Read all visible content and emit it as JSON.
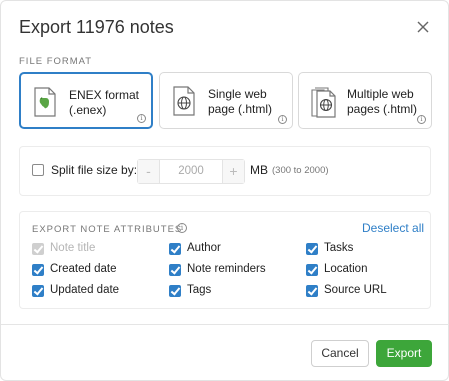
{
  "dialog": {
    "title": "Export 11976 notes",
    "close_icon": "close-icon"
  },
  "file_format": {
    "section_label": "FILE FORMAT",
    "options": [
      {
        "line1": "ENEX format",
        "line2": "(.enex)",
        "icon": "evernote-file-icon",
        "selected": true
      },
      {
        "line1": "Single web",
        "line2": "page (.html)",
        "icon": "globe-file-icon",
        "selected": false
      },
      {
        "line1": "Multiple web",
        "line2": "pages (.html)",
        "icon": "globe-files-icon",
        "selected": false
      }
    ],
    "info_glyph": "i"
  },
  "split": {
    "label": "Split file size by:",
    "checked": false,
    "minus": "-",
    "value": "2000",
    "plus": "+",
    "unit": "MB",
    "range": "(300 to 2000)"
  },
  "attributes": {
    "title": "EXPORT NOTE ATTRIBUTES",
    "info_glyph": "i",
    "deselect_all": "Deselect all",
    "items": [
      {
        "label": "Note title",
        "checked": true,
        "disabled": true
      },
      {
        "label": "Created date",
        "checked": true,
        "disabled": false
      },
      {
        "label": "Updated date",
        "checked": true,
        "disabled": false
      },
      {
        "label": "Author",
        "checked": true,
        "disabled": false
      },
      {
        "label": "Note reminders",
        "checked": true,
        "disabled": false
      },
      {
        "label": "Tags",
        "checked": true,
        "disabled": false
      },
      {
        "label": "Tasks",
        "checked": true,
        "disabled": false
      },
      {
        "label": "Location",
        "checked": true,
        "disabled": false
      },
      {
        "label": "Source URL",
        "checked": true,
        "disabled": false
      }
    ]
  },
  "footer": {
    "cancel": "Cancel",
    "export": "Export"
  },
  "colors": {
    "accent_blue": "#2f7fc7",
    "export_green": "#3da63a",
    "evernote_green": "#5aa545"
  }
}
